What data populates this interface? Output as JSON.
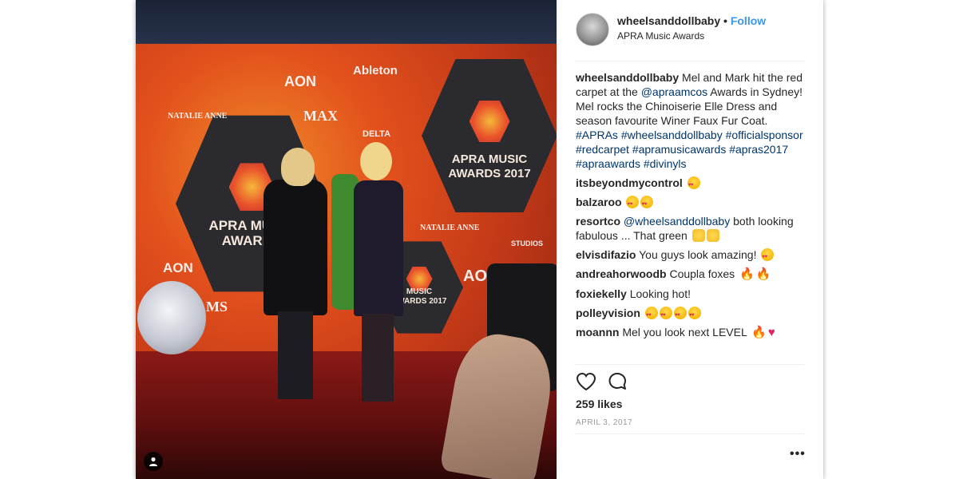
{
  "post": {
    "username": "wheelsanddollbaby",
    "separator": "•",
    "follow_label": "Follow",
    "location": "APRA Music Awards"
  },
  "photo": {
    "backdrop_texts": {
      "apra1": "APRA MUSIC",
      "apra2": "AWARDS 2017",
      "apra_left1": "APRA MUSIC",
      "apra_left2": "AWARDS",
      "apra_small1": "MUSIC",
      "apra_small2": "AWARDS 2017",
      "ableton": "Ableton",
      "aon_top": "AON",
      "aon_left": "AON",
      "aon_right": "AON",
      "max": "MAX",
      "delta": "DELTA",
      "natalie_top": "NATALIE ANNE",
      "natalie_mid": "NATALIE ANNE",
      "studios": "STUDIOS",
      "ms": "MS"
    },
    "badge_icon": "user-tag-icon"
  },
  "caption": {
    "user": "wheelsanddollbaby",
    "line1_text": " Mel and Mark hit the red carpet at the ",
    "mention": "@apraamcos",
    "line1_rest": " Awards in Sydney!",
    "line2": "Mel rocks the Chinoiserie Elle Dress and season favourite Winer Faux Fur Coat.",
    "hashtags": [
      "#APRAs",
      "#wheelsanddollbaby",
      "#officialsponsor",
      "#redcarpet",
      "#apramusicawards",
      "#apras2017",
      "#apraawards",
      "#divinyls"
    ]
  },
  "comments": [
    {
      "user": "itsbeyondmycontrol",
      "text": "",
      "emoji": [
        "heart-eyes"
      ]
    },
    {
      "user": "balzaroo",
      "text": "",
      "emoji": [
        "heart-eyes",
        "heart-eyes"
      ]
    },
    {
      "user": "resortco",
      "mention": "@wheelsanddollbaby",
      "text": " both looking fabulous ... That green ",
      "emoji": [
        "hands",
        "hands"
      ]
    },
    {
      "user": "elvisdifazio",
      "text": "You guys look amazing! ",
      "emoji": [
        "heart-eyes"
      ]
    },
    {
      "user": "andreahorwoodb",
      "text": "Coupla foxes ",
      "emoji": [
        "fire",
        "fire"
      ]
    },
    {
      "user": "foxiekelly",
      "text": "Looking hot!",
      "emoji": []
    },
    {
      "user": "polleyvision",
      "text": "",
      "emoji": [
        "heart-eyes",
        "heart-eyes",
        "heart-eyes",
        "heart-eyes"
      ]
    },
    {
      "user": "moannn",
      "text": "Mel you look next LEVEL ",
      "emoji": [
        "fire",
        "heart"
      ]
    }
  ],
  "actions": {
    "like_icon": "heart-outline-icon",
    "comment_icon": "comment-bubble-icon"
  },
  "likes": "259 likes",
  "date": "APRIL 3, 2017",
  "more_label": "•••"
}
